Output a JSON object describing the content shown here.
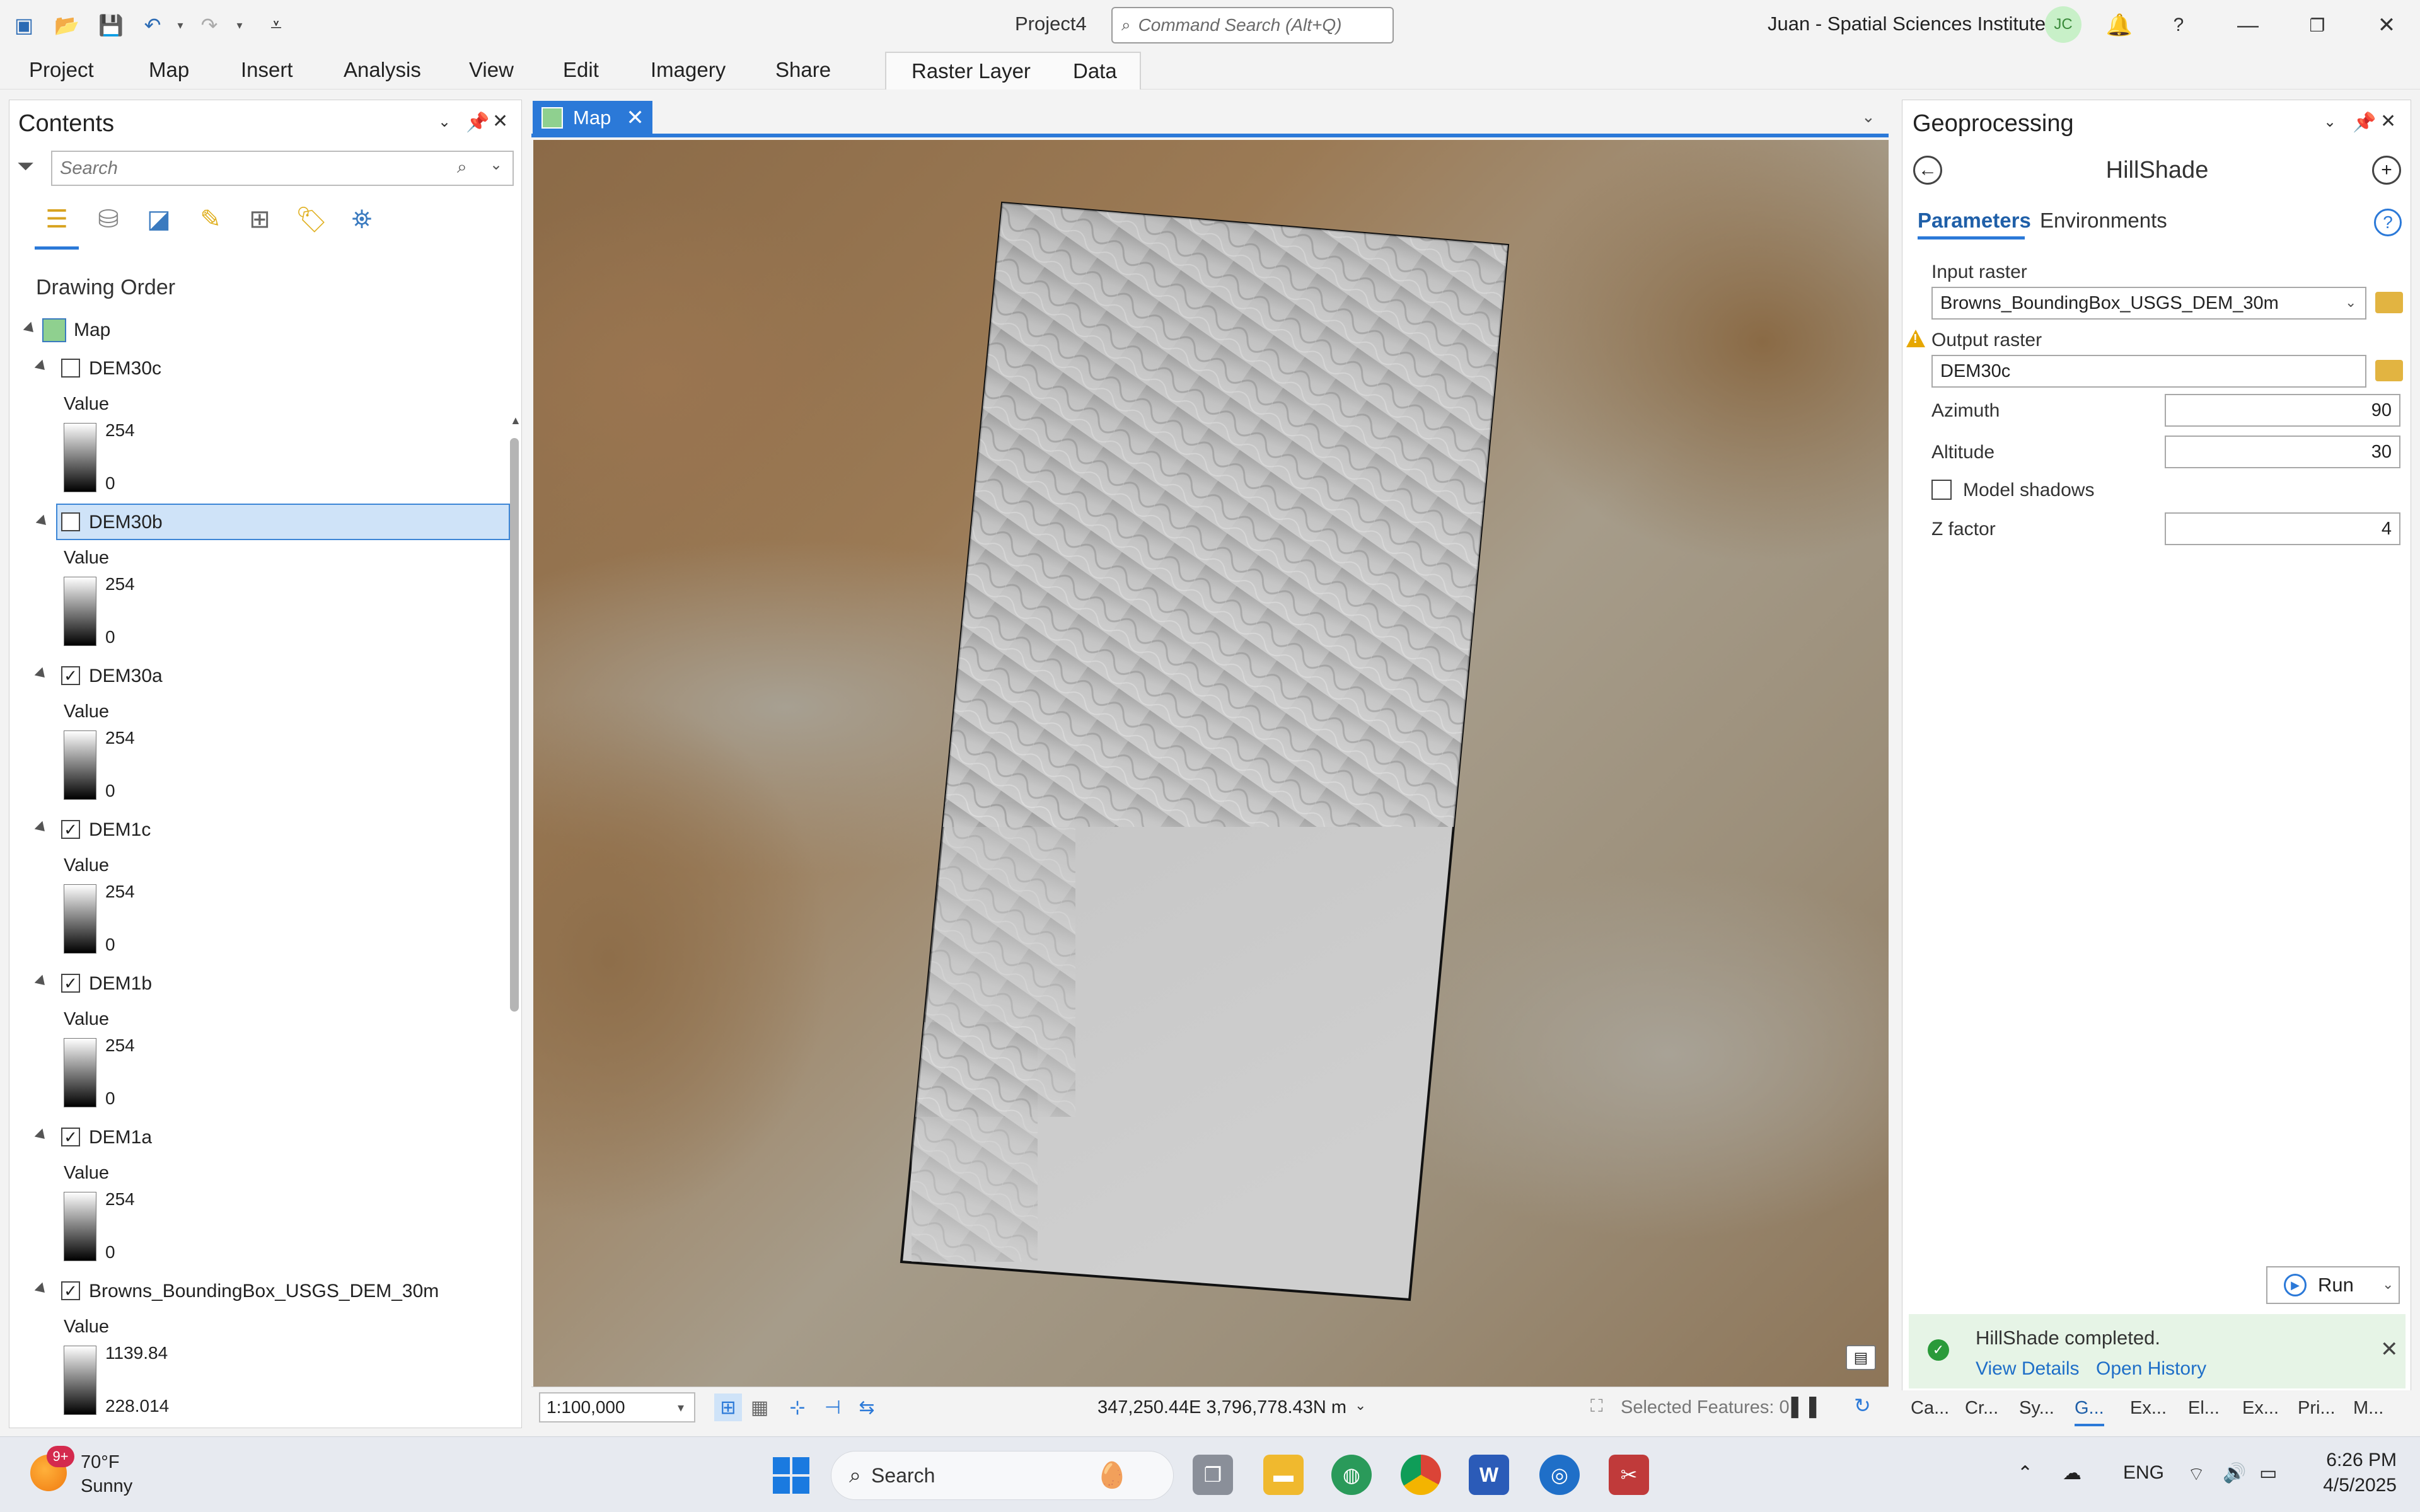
{
  "app": {
    "project_title": "Project4",
    "command_search_placeholder": "Command Search (Alt+Q)",
    "user": "Juan - Spatial Sciences Institute",
    "avatar_initials": "JC",
    "accent_color": "#2b79d8"
  },
  "ribbon": {
    "tabs": [
      "Project",
      "Map",
      "Insert",
      "Analysis",
      "View",
      "Edit",
      "Imagery",
      "Share"
    ],
    "context_tabs": [
      "Raster Layer",
      "Data"
    ]
  },
  "contents": {
    "title": "Contents",
    "search_placeholder": "Search",
    "section": "Drawing Order",
    "map_label": "Map",
    "layers": [
      {
        "name": "DEM30c",
        "checked": false,
        "selected": false,
        "legend_label": "Value",
        "max": "254",
        "min": "0"
      },
      {
        "name": "DEM30b",
        "checked": false,
        "selected": true,
        "legend_label": "Value",
        "max": "254",
        "min": "0"
      },
      {
        "name": "DEM30a",
        "checked": true,
        "selected": false,
        "legend_label": "Value",
        "max": "254",
        "min": "0"
      },
      {
        "name": "DEM1c",
        "checked": true,
        "selected": false,
        "legend_label": "Value",
        "max": "254",
        "min": "0"
      },
      {
        "name": "DEM1b",
        "checked": true,
        "selected": false,
        "legend_label": "Value",
        "max": "254",
        "min": "0"
      },
      {
        "name": "DEM1a",
        "checked": true,
        "selected": false,
        "legend_label": "Value",
        "max": "254",
        "min": "0"
      },
      {
        "name": "Browns_BoundingBox_USGS_DEM_30m",
        "checked": true,
        "selected": false,
        "legend_label": "Value",
        "max": "1139.84",
        "min": "228.014"
      }
    ]
  },
  "map": {
    "tab_label": "Map",
    "scale": "1:100,000",
    "coordinates": "347,250.44E 3,796,778.43N m",
    "selected_features": "Selected Features: 0"
  },
  "geoprocessing": {
    "title": "Geoprocessing",
    "tool": "HillShade",
    "tabs": [
      "Parameters",
      "Environments"
    ],
    "input_raster_label": "Input raster",
    "input_raster_value": "Browns_BoundingBox_USGS_DEM_30m",
    "output_raster_label": "Output raster",
    "output_raster_value": "DEM30c",
    "azimuth_label": "Azimuth",
    "azimuth_value": "90",
    "altitude_label": "Altitude",
    "altitude_value": "30",
    "model_shadows_label": "Model shadows",
    "z_factor_label": "Z factor",
    "z_factor_value": "4",
    "run_label": "Run",
    "notice_message": "HillShade completed.",
    "notice_link_details": "View Details",
    "notice_link_history": "Open History",
    "bottom_tabs": [
      "Ca...",
      "Cr...",
      "Sy...",
      "G...",
      "Ex...",
      "El...",
      "Ex...",
      "Pri...",
      "M..."
    ]
  },
  "taskbar": {
    "weather_badge": "9+",
    "weather_temp": "70°F",
    "weather_condition": "Sunny",
    "search_label": "Search",
    "language": "ENG",
    "time": "6:26 PM",
    "date": "4/5/2025"
  }
}
